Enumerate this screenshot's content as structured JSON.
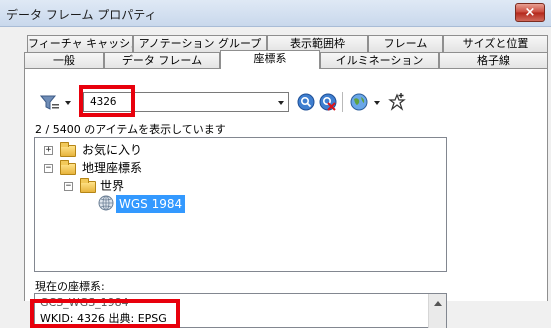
{
  "window": {
    "title": "データ フレーム プロパティ",
    "close_glyph": "×"
  },
  "tabs_row1": [
    "フィーチャ キャッシュ",
    "アノテーション グループ",
    "表示範囲枠",
    "フレーム",
    "サイズと位置"
  ],
  "tabs_row2": [
    "一般",
    "データ フレーム",
    "座標系",
    "イルミネーション",
    "格子線"
  ],
  "active_tab": "座標系",
  "search": {
    "value": "4326"
  },
  "toolbar_icons": [
    "filter-icon",
    "search-icon",
    "clear-search-icon",
    "globe-icon",
    "add-favorite-icon"
  ],
  "count_text": "2 / 5400 のアイテムを表示しています",
  "tree": {
    "favorites": "お気に入り",
    "geographic": "地理座標系",
    "world": "世界",
    "wgs84": "WGS 1984"
  },
  "current_label": "現在の座標系:",
  "details": {
    "line1": "GCS_WGS_1984",
    "line2": "WKID: 4326 出典: EPSG"
  },
  "colors": {
    "highlight": "#e8000c",
    "selection": "#3399ff"
  }
}
